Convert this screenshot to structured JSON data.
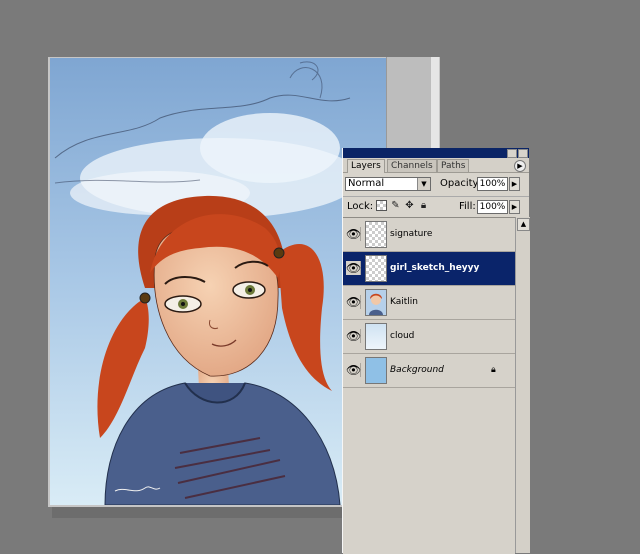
{
  "palette": {
    "tabs": [
      "Layers",
      "Channels",
      "Paths"
    ],
    "blend_mode": "Normal",
    "opacity_label": "Opacity:",
    "opacity_value": "100%",
    "lock_label": "Lock:",
    "fill_label": "Fill:",
    "fill_value": "100%",
    "layers": [
      {
        "name": "signature",
        "selected": false,
        "thumb": "transparent-checker"
      },
      {
        "name": "girl_sketch_heyyy",
        "selected": true,
        "thumb": "transparent-checker"
      },
      {
        "name": "Kaitlin",
        "selected": false,
        "thumb": "girl-portrait"
      },
      {
        "name": "cloud",
        "selected": false,
        "thumb": "light-blue-cloud"
      },
      {
        "name": "Background",
        "selected": false,
        "thumb": "solid-blue",
        "locked": true
      }
    ]
  },
  "icons": {
    "visibility": "eye-icon",
    "lock_transparent": "checker-lock-icon",
    "lock_paint": "brush-icon",
    "lock_move": "move-icon",
    "lock_all": "padlock-icon",
    "palette_menu": "arrow-right-circle-icon"
  },
  "colors": {
    "workspace": "#7a7a7a",
    "selection": "#0a246a",
    "sky": "#8fb6dc",
    "hair": "#c8461d",
    "sweater": "#4a5f8c"
  }
}
